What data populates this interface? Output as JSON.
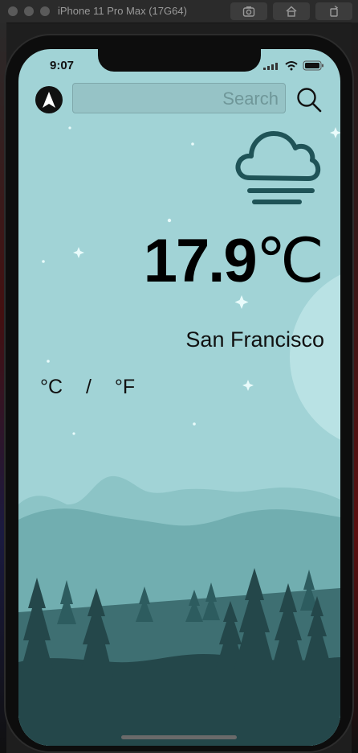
{
  "simulator": {
    "title": "iPhone 11 Pro Max (17G64)"
  },
  "status_bar": {
    "time": "9:07"
  },
  "header": {
    "search_placeholder": "Search",
    "navigate_icon": "navigation-arrow-icon",
    "search_icon": "magnifier-icon"
  },
  "weather": {
    "icon": "cloud-fog-icon",
    "temperature": "17.9",
    "unit_symbol": "℃",
    "city": "San Francisco"
  },
  "units": {
    "celsius": "°C",
    "separator": "/",
    "fahrenheit": "°F"
  },
  "colors": {
    "sky": "#a1d3d6",
    "moon": "#b9e2e4",
    "mountains_far": "#8cc4c6",
    "mountains_mid": "#71aeb0",
    "hills": "#3e6f72",
    "forest": "#24474a",
    "icon_stroke": "#1f5357"
  }
}
